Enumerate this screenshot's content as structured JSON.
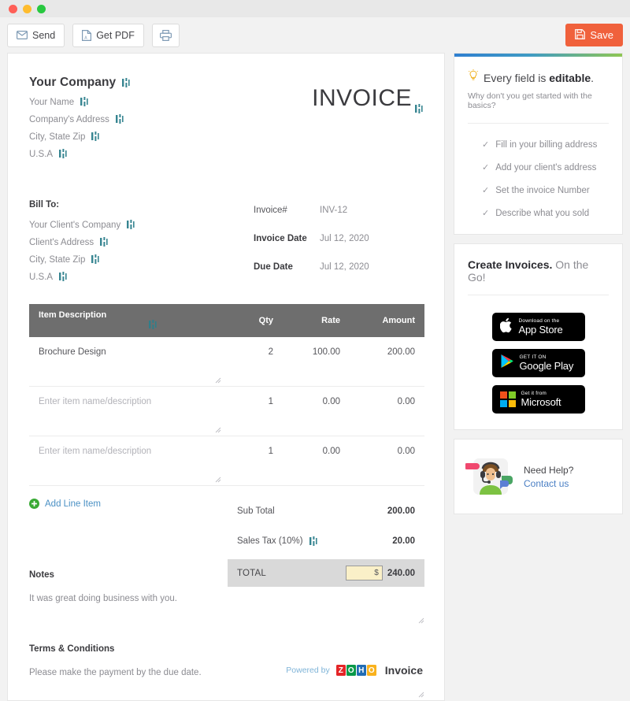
{
  "window": {
    "controls": [
      "close",
      "minimize",
      "maximize"
    ]
  },
  "toolbar": {
    "send_label": "Send",
    "getpdf_label": "Get PDF",
    "print_label": "",
    "save_label": "Save"
  },
  "invoice": {
    "title": "INVOICE",
    "company": {
      "name": "Your Company",
      "lines": [
        "Your Name",
        "Company's Address",
        "City, State Zip",
        "U.S.A"
      ]
    },
    "bill_to": {
      "label": "Bill To:",
      "lines": [
        "Your Client's Company",
        "Client's Address",
        "City, State Zip",
        "U.S.A"
      ]
    },
    "meta": [
      {
        "label": "Invoice#",
        "value": "INV-12"
      },
      {
        "label": "Invoice Date",
        "value": "Jul 12, 2020"
      },
      {
        "label": "Due Date",
        "value": "Jul 12, 2020"
      }
    ],
    "table": {
      "headers": [
        "Item Description",
        "Qty",
        "Rate",
        "Amount"
      ],
      "rows": [
        {
          "description": "Brochure Design",
          "placeholder": false,
          "qty": "2",
          "rate": "100.00",
          "amount": "200.00"
        },
        {
          "description": "Enter item name/description",
          "placeholder": true,
          "qty": "1",
          "rate": "0.00",
          "amount": "0.00"
        },
        {
          "description": "Enter item name/description",
          "placeholder": true,
          "qty": "1",
          "rate": "0.00",
          "amount": "0.00"
        }
      ]
    },
    "add_line_item": "Add Line Item",
    "totals": {
      "subtotal_label": "Sub Total",
      "subtotal_value": "200.00",
      "tax_label": "Sales Tax (10%)",
      "tax_value": "20.00",
      "total_label": "TOTAL",
      "currency_symbol": "$",
      "total_value": "240.00"
    },
    "notes": {
      "title": "Notes",
      "body": "It was great doing business with you."
    },
    "terms": {
      "title": "Terms & Conditions",
      "body": "Please make the payment by the due date."
    },
    "footer": {
      "powered_by": "Powered by",
      "brand_letters": [
        "Z",
        "O",
        "H",
        "O"
      ],
      "brand_colors": [
        "#e42527",
        "#089949",
        "#226db4",
        "#f9b21d"
      ],
      "product": "Invoice"
    }
  },
  "sidebar": {
    "tip_card": {
      "title_plain": "Every field is ",
      "title_bold": "editable",
      "title_period": ".",
      "subtitle": "Why don't you get started with the basics?",
      "checks": [
        "Fill in your billing address",
        "Add your client's address",
        "Set the invoice Number",
        "Describe what you sold"
      ]
    },
    "apps_card": {
      "title_bold": "Create Invoices.",
      "title_light": " On the Go!",
      "badges": [
        {
          "small": "Download on the",
          "big": "App Store",
          "icon": "apple-icon"
        },
        {
          "small": "GET IT ON",
          "big": "Google Play",
          "icon": "google-play-icon"
        },
        {
          "small": "Get it from",
          "big": "Microsoft",
          "icon": "microsoft-icon"
        }
      ]
    },
    "help_card": {
      "heading": "Need Help?",
      "link": "Contact us"
    }
  },
  "colors": {
    "accent_orange": "#f0613c",
    "link_blue": "#4a90c4",
    "table_header": "#6e6e6e",
    "total_bg": "#d9d9d9"
  }
}
